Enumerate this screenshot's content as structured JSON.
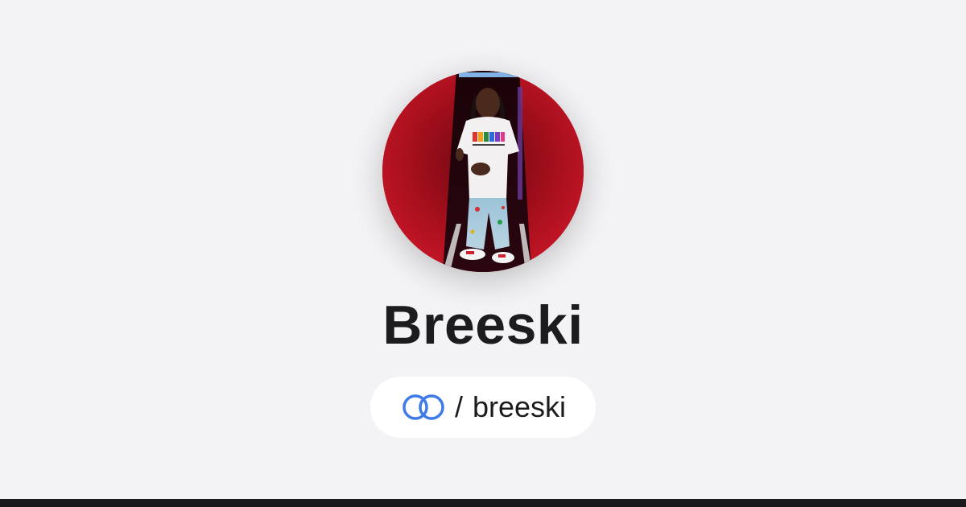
{
  "profile": {
    "display_name": "Breeski",
    "handle_prefix": "/",
    "handle": "breeski"
  },
  "icons": {
    "link": "link-rings-icon"
  },
  "colors": {
    "background": "#f3f3f5",
    "accent": "#3f7be8",
    "text": "#1c1c1e",
    "bottom_bar": "#1a1a1c",
    "avatar_bg": "#b3101c"
  }
}
